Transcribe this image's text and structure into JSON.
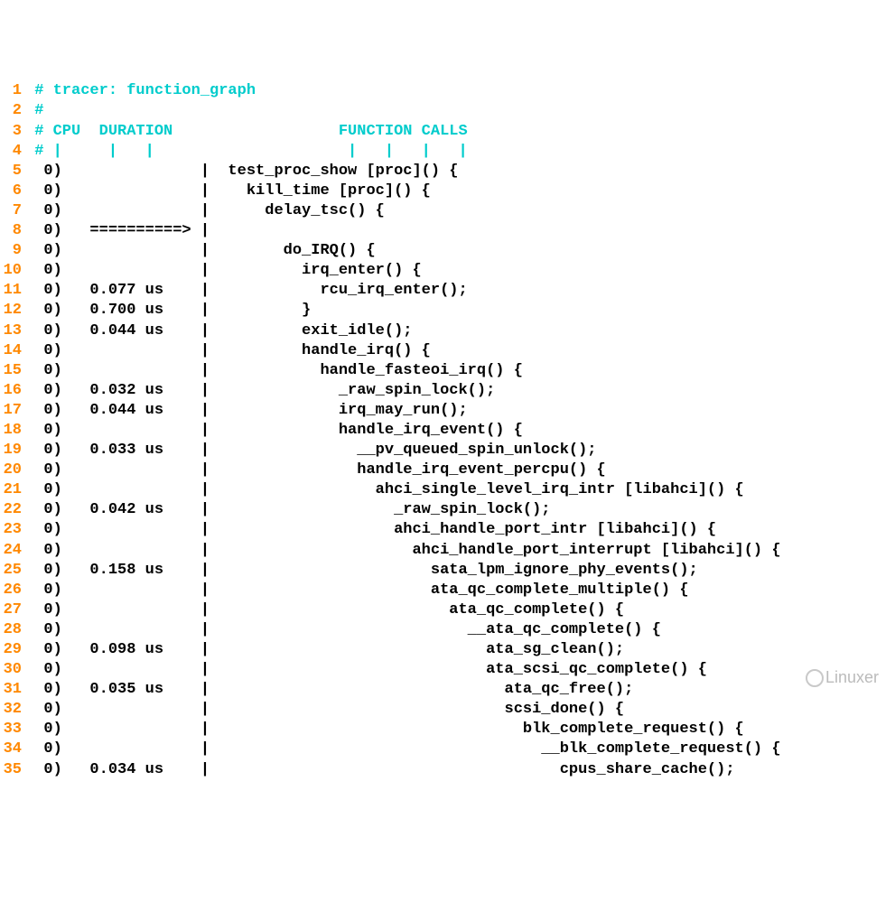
{
  "lines": [
    {
      "n": "1",
      "hl": true,
      "text": " # tracer: function_graph"
    },
    {
      "n": "2",
      "hl": true,
      "text": " #"
    },
    {
      "n": "3",
      "hl": true,
      "text": " # CPU  DURATION                  FUNCTION CALLS"
    },
    {
      "n": "4",
      "hl": true,
      "text": " # |     |   |                     |   |   |   |"
    },
    {
      "n": "5",
      "hl": false,
      "text": "  0)               |  test_proc_show [proc]() {"
    },
    {
      "n": "6",
      "hl": false,
      "text": "  0)               |    kill_time [proc]() {"
    },
    {
      "n": "7",
      "hl": false,
      "text": "  0)               |      delay_tsc() {"
    },
    {
      "n": "8",
      "hl": false,
      "text": "  0)   ==========> |"
    },
    {
      "n": "9",
      "hl": false,
      "text": "  0)               |        do_IRQ() {"
    },
    {
      "n": "10",
      "hl": false,
      "text": "  0)               |          irq_enter() {"
    },
    {
      "n": "11",
      "hl": false,
      "text": "  0)   0.077 us    |            rcu_irq_enter();"
    },
    {
      "n": "12",
      "hl": false,
      "text": "  0)   0.700 us    |          }"
    },
    {
      "n": "13",
      "hl": false,
      "text": "  0)   0.044 us    |          exit_idle();"
    },
    {
      "n": "14",
      "hl": false,
      "text": "  0)               |          handle_irq() {"
    },
    {
      "n": "15",
      "hl": false,
      "text": "  0)               |            handle_fasteoi_irq() {"
    },
    {
      "n": "16",
      "hl": false,
      "text": "  0)   0.032 us    |              _raw_spin_lock();"
    },
    {
      "n": "17",
      "hl": false,
      "text": "  0)   0.044 us    |              irq_may_run();"
    },
    {
      "n": "18",
      "hl": false,
      "text": "  0)               |              handle_irq_event() {"
    },
    {
      "n": "19",
      "hl": false,
      "text": "  0)   0.033 us    |                __pv_queued_spin_unlock();"
    },
    {
      "n": "20",
      "hl": false,
      "text": "  0)               |                handle_irq_event_percpu() {"
    },
    {
      "n": "21",
      "hl": false,
      "text": "  0)               |                  ahci_single_level_irq_intr [libahci]() {"
    },
    {
      "n": "22",
      "hl": false,
      "text": "  0)   0.042 us    |                    _raw_spin_lock();"
    },
    {
      "n": "23",
      "hl": false,
      "text": "  0)               |                    ahci_handle_port_intr [libahci]() {"
    },
    {
      "n": "24",
      "hl": false,
      "text": "  0)               |                      ahci_handle_port_interrupt [libahci]() {"
    },
    {
      "n": "25",
      "hl": false,
      "text": "  0)   0.158 us    |                        sata_lpm_ignore_phy_events();"
    },
    {
      "n": "26",
      "hl": false,
      "text": "  0)               |                        ata_qc_complete_multiple() {"
    },
    {
      "n": "27",
      "hl": false,
      "text": "  0)               |                          ata_qc_complete() {"
    },
    {
      "n": "28",
      "hl": false,
      "text": "  0)               |                            __ata_qc_complete() {"
    },
    {
      "n": "29",
      "hl": false,
      "text": "  0)   0.098 us    |                              ata_sg_clean();"
    },
    {
      "n": "30",
      "hl": false,
      "text": "  0)               |                              ata_scsi_qc_complete() {"
    },
    {
      "n": "31",
      "hl": false,
      "text": "  0)   0.035 us    |                                ata_qc_free();"
    },
    {
      "n": "32",
      "hl": false,
      "text": "  0)               |                                scsi_done() {"
    },
    {
      "n": "33",
      "hl": false,
      "text": "  0)               |                                  blk_complete_request() {"
    },
    {
      "n": "34",
      "hl": false,
      "text": "  0)               |                                    __blk_complete_request() {"
    },
    {
      "n": "35",
      "hl": false,
      "text": "  0)   0.034 us    |                                      cpus_share_cache();"
    }
  ],
  "watermark": "Linuxer"
}
